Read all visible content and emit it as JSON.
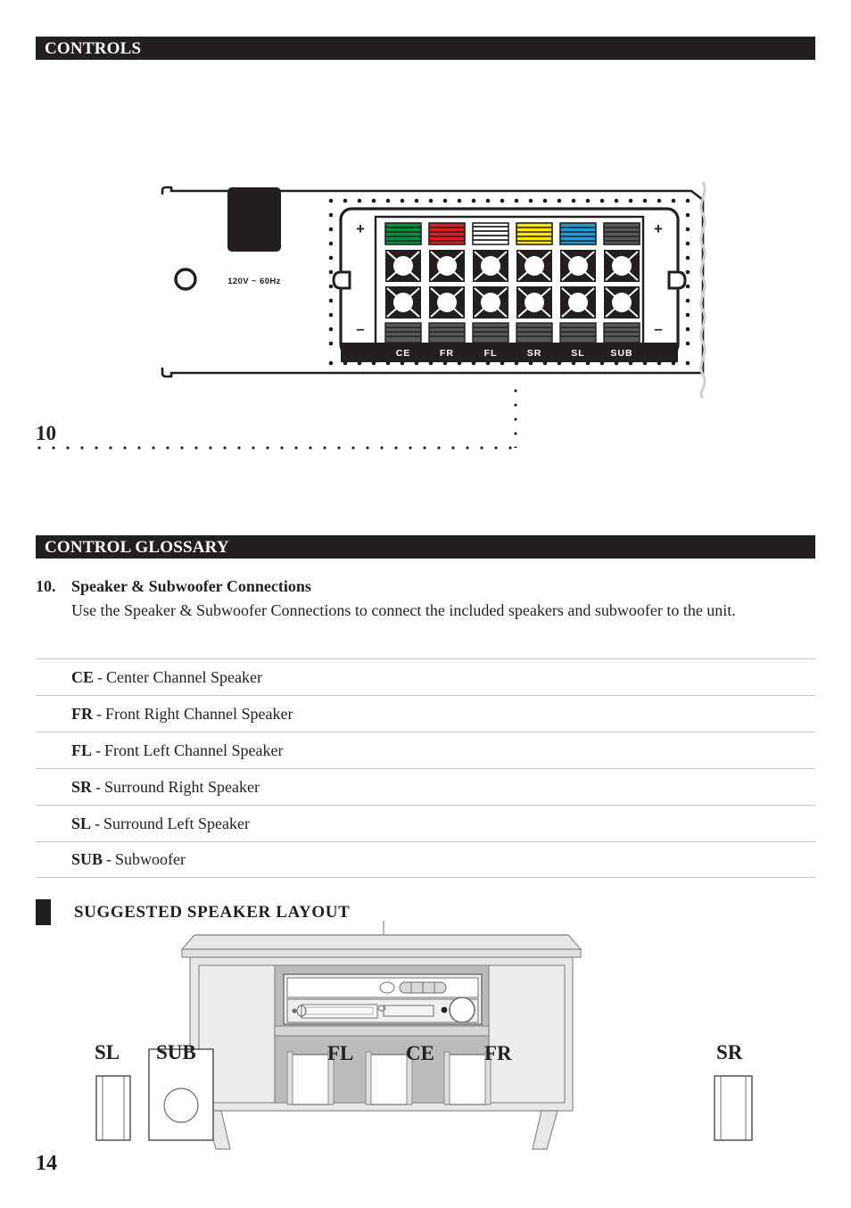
{
  "page": {
    "number": "14"
  },
  "sections": {
    "controls": {
      "title": "CONTROLS"
    },
    "glossary": {
      "title": "CONTROL GLOSSARY"
    }
  },
  "device_figure": {
    "power_rating_label": "120V ~ 60Hz",
    "polarity_plus": "+",
    "polarity_minus": "–",
    "terminal_labels": [
      "CE",
      "FR",
      "FL",
      "SR",
      "SL",
      "SUB"
    ],
    "terminal_colors": [
      "#00913f",
      "#e01b22",
      "#ffffff",
      "#ffe600",
      "#1b9ad6",
      "#58595b"
    ],
    "callout": "10"
  },
  "glossary_entry": {
    "number": "10.",
    "title": "Speaker & Subwoofer Connections",
    "description": "Use the Speaker & Subwoofer Connections to connect the included speakers and subwoofer to the unit."
  },
  "glossary_items": [
    {
      "abbr": "CE",
      "dash": "-",
      "text": "Center Channel Speaker"
    },
    {
      "abbr": "FR",
      "dash": "-",
      "text": "Front Right Channel Speaker"
    },
    {
      "abbr": "FL",
      "dash": "-",
      "text": "Front Left Channel Speaker"
    },
    {
      "abbr": "SR",
      "dash": "-",
      "text": "Surround Right Speaker"
    },
    {
      "abbr": "SL",
      "dash": "-",
      "text": "Surround Left Speaker"
    },
    {
      "abbr": "SUB",
      "dash": "-",
      "text": "Subwoofer"
    }
  ],
  "layout_section": {
    "title": "SUGGESTED SPEAKER LAYOUT",
    "speakers": {
      "sl": "SL",
      "sub": "SUB",
      "fl": "FL",
      "ce": "CE",
      "fr": "FR",
      "sr": "SR"
    }
  },
  "colors": {
    "ink": "#231f20",
    "rule": "#c9c9c9",
    "furniture_light": "#e8e8e8",
    "furniture_mid": "#bcbcbc",
    "furniture_dark": "#a8a8a8"
  }
}
